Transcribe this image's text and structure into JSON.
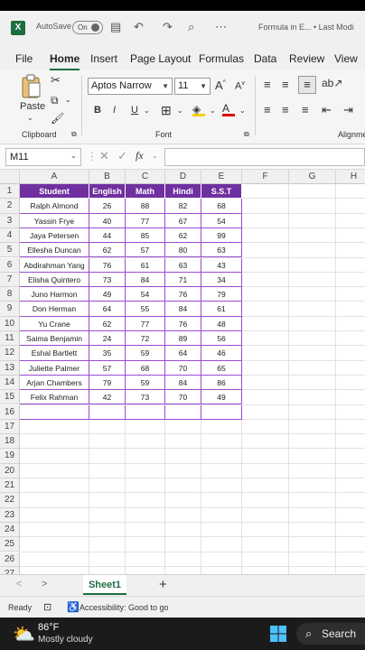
{
  "titlebar": {
    "app_icon": "X",
    "autosave_label": "AutoSave",
    "autosave_state": "On",
    "document_title": "Formula in E... • Last Modi"
  },
  "menu": {
    "tabs": [
      "File",
      "Home",
      "Insert",
      "Page Layout",
      "Formulas",
      "Data",
      "Review",
      "View"
    ],
    "active": "Home"
  },
  "ribbon": {
    "paste_label": "Paste",
    "font_name": "Aptos Narrow",
    "font_size": "11",
    "clipboard_label": "Clipboard",
    "font_label": "Font",
    "alignment_label": "Alignme",
    "bold": "B",
    "italic": "I",
    "underline": "U",
    "grow_font": "A",
    "shrink_font": "A"
  },
  "formula_bar": {
    "name_box": "M11",
    "fx": "fx",
    "value": ""
  },
  "sheet": {
    "columns": [
      "A",
      "B",
      "C",
      "D",
      "E",
      "F",
      "G",
      "H"
    ],
    "headers": [
      "Student",
      "English",
      "Math",
      "Hindi",
      "S.S.T"
    ],
    "rows": [
      [
        "Ralph Almond",
        "26",
        "88",
        "82",
        "68"
      ],
      [
        "Yassin Frye",
        "40",
        "77",
        "67",
        "54"
      ],
      [
        "Jaya Petersen",
        "44",
        "85",
        "62",
        "99"
      ],
      [
        "Ellesha Duncan",
        "62",
        "57",
        "80",
        "63"
      ],
      [
        "Abdirahman Yang",
        "76",
        "61",
        "63",
        "43"
      ],
      [
        "Elisha Quintero",
        "73",
        "84",
        "71",
        "34"
      ],
      [
        "Juno Harmon",
        "49",
        "54",
        "76",
        "79"
      ],
      [
        "Don Herman",
        "64",
        "55",
        "84",
        "61"
      ],
      [
        "Yu Crane",
        "62",
        "77",
        "76",
        "48"
      ],
      [
        "Saima Benjamin",
        "24",
        "72",
        "89",
        "56"
      ],
      [
        "Eshal Bartlett",
        "35",
        "59",
        "64",
        "46"
      ],
      [
        "Juliette Palmer",
        "57",
        "68",
        "70",
        "65"
      ],
      [
        "Arjan Chambers",
        "79",
        "59",
        "84",
        "86"
      ],
      [
        "Felix Rahman",
        "42",
        "73",
        "70",
        "49"
      ]
    ],
    "row_numbers": [
      "1",
      "2",
      "3",
      "4",
      "5",
      "6",
      "7",
      "8",
      "9",
      "10",
      "11",
      "12",
      "13",
      "14",
      "15",
      "16",
      "17",
      "18",
      "19",
      "20",
      "21",
      "22",
      "23",
      "24",
      "25",
      "26",
      "27"
    ],
    "header_color": "#7030a0",
    "border_color": "#9b4bd1"
  },
  "sheet_tabs": {
    "active": "Sheet1",
    "add": "+",
    "prev": "<",
    "next": ">"
  },
  "status": {
    "ready": "Ready",
    "accessibility": "Accessibility: Good to go"
  },
  "taskbar": {
    "temperature": "86°F",
    "weather": "Mostly cloudy",
    "search": "Search"
  }
}
